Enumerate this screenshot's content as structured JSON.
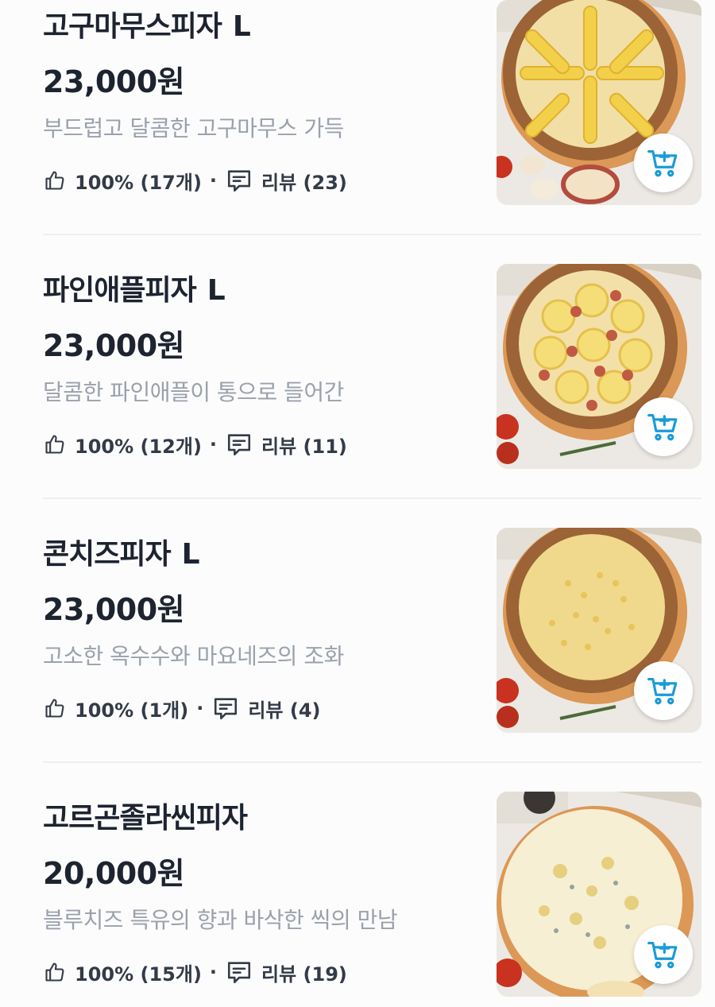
{
  "menu": {
    "items": [
      {
        "name": "고구마무스피자",
        "size": "L",
        "price": "23,000원",
        "description": "부드럽고 달콤한 고구마무스 가득",
        "like_rate": "100% (17개)",
        "separator": "·",
        "review": "리뷰 (23)",
        "topping": "sweet-potato"
      },
      {
        "name": "파인애플피자",
        "size": "L",
        "price": "23,000원",
        "description": "달콤한 파인애플이 통으로 들어간",
        "like_rate": "100% (12개)",
        "separator": "·",
        "review": "리뷰 (11)",
        "topping": "pineapple"
      },
      {
        "name": "콘치즈피자",
        "size": "L",
        "price": "23,000원",
        "description": "고소한 옥수수와 마요네즈의 조화",
        "like_rate": "100% (1개)",
        "separator": "·",
        "review": "리뷰 (4)",
        "topping": "corn"
      },
      {
        "name": "고르곤졸라씬피자",
        "size": "",
        "price": "20,000원",
        "description": "블루치즈 특유의 향과 바삭한 씩의 만남",
        "like_rate": "100% (15개)",
        "separator": "·",
        "review": "리뷰 (19)",
        "topping": "gorgonzola"
      }
    ]
  },
  "icons": {
    "like": "thumbs-up-icon",
    "review": "speech-bubble-icon",
    "cart": "cart-add-icon"
  },
  "colors": {
    "accent": "#1a9bd7",
    "title": "#1d2430",
    "description": "#9aa1ab",
    "divider": "#eceef2"
  }
}
